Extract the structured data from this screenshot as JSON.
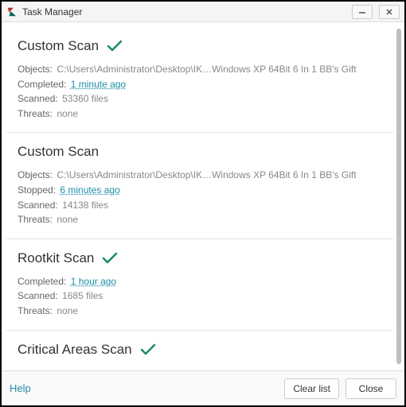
{
  "window": {
    "title": "Task Manager"
  },
  "tasks": [
    {
      "title": "Custom Scan",
      "check": true,
      "lines": [
        {
          "label": "Objects:",
          "value": "C:\\Users\\Administrator\\Desktop\\IK…Windows XP 64Bit 6 In 1 BB's Gift",
          "is_time": false
        },
        {
          "label": "Completed:",
          "value": "1 minute ago",
          "is_time": true
        },
        {
          "label": "Scanned:",
          "value": "53360 files",
          "is_time": false
        },
        {
          "label": "Threats:",
          "value": "none",
          "is_time": false
        }
      ]
    },
    {
      "title": "Custom Scan",
      "check": false,
      "lines": [
        {
          "label": "Objects:",
          "value": "C:\\Users\\Administrator\\Desktop\\IK…Windows XP 64Bit 6 In 1 BB's Gift",
          "is_time": false
        },
        {
          "label": "Stopped:",
          "value": "6 minutes ago",
          "is_time": true
        },
        {
          "label": "Scanned:",
          "value": "14138 files",
          "is_time": false
        },
        {
          "label": "Threats:",
          "value": "none",
          "is_time": false
        }
      ]
    },
    {
      "title": "Rootkit Scan",
      "check": true,
      "lines": [
        {
          "label": "Completed:",
          "value": "1 hour ago",
          "is_time": true
        },
        {
          "label": "Scanned:",
          "value": "1685 files",
          "is_time": false
        },
        {
          "label": "Threats:",
          "value": "none",
          "is_time": false
        }
      ]
    },
    {
      "title": "Critical Areas Scan",
      "check": true,
      "lines": []
    }
  ],
  "footer": {
    "help": "Help",
    "clear": "Clear list",
    "close": "Close"
  }
}
